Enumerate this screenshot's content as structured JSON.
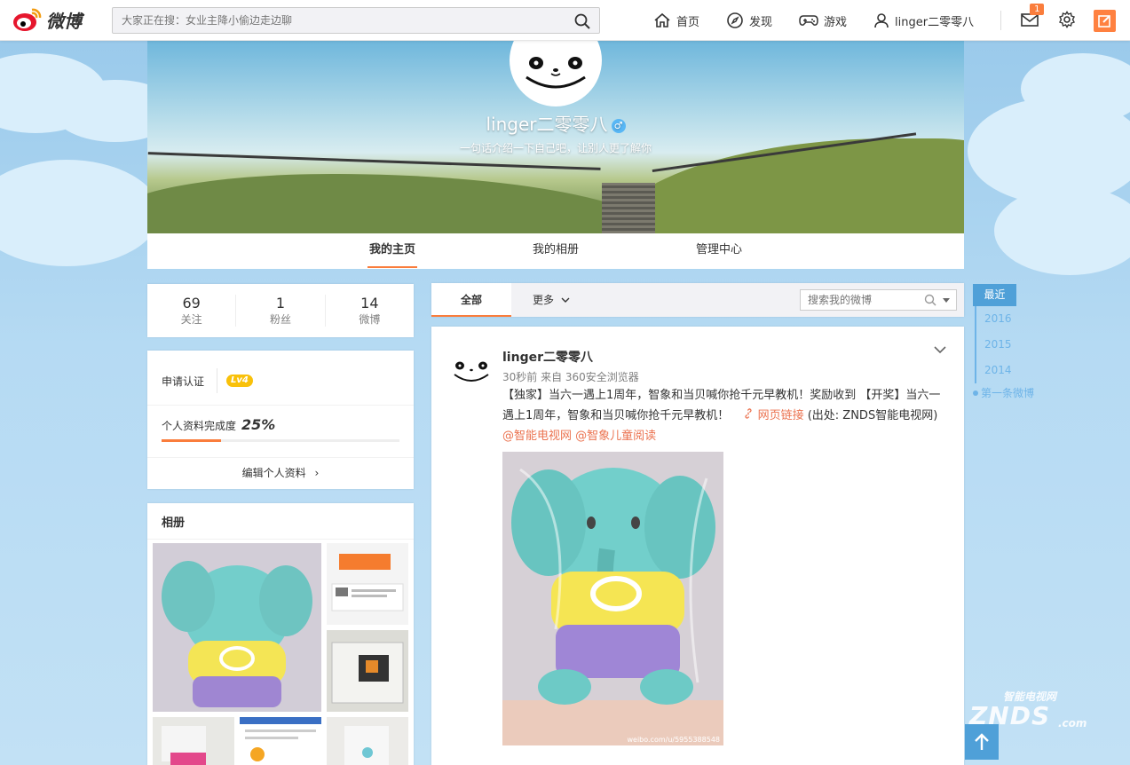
{
  "topbar": {
    "logo_text": "微博",
    "search_placeholder": "大家正在搜：女业主降小偷边走边聊",
    "nav": {
      "home": "首页",
      "discover": "发现",
      "game": "游戏",
      "user": "linger二零零八"
    },
    "message_badge": "1"
  },
  "profile": {
    "name": "linger二零零八",
    "gender_symbol": "♂",
    "intro": "一句话介绍一下自己吧，让别人更了解你"
  },
  "tabs": [
    "我的主页",
    "我的相册",
    "管理中心"
  ],
  "stats": [
    {
      "num": "69",
      "label": "关注"
    },
    {
      "num": "1",
      "label": "粉丝"
    },
    {
      "num": "14",
      "label": "微博"
    }
  ],
  "verify": {
    "apply_label": "申请认证",
    "level": "Lv4",
    "completeness_label": "个人资料完成度",
    "completeness_value": "25%",
    "completeness_fraction": 0.25,
    "edit_label": "编辑个人资料"
  },
  "album": {
    "title": "相册"
  },
  "feed": {
    "tab_all": "全部",
    "tab_more": "更多",
    "search_placeholder": "搜索我的微博"
  },
  "post": {
    "author": "linger二零零八",
    "meta": "30秒前 来自 360安全浏览器",
    "text_1": "【独家】当六一遇上1周年，智象和当贝喊你抢千元早教机！奖励收到 【开奖】当六一遇上1周年，智象和当贝喊你抢千元早教机！",
    "link_text": "网页链接",
    "text_2": "(出处: ZNDS智能电视网)",
    "mention_1": "@智能电视网",
    "mention_2": "@智象儿童阅读",
    "image_watermark": "weibo.com/u/5955388548"
  },
  "timeline": {
    "recent": "最近",
    "years": [
      "2016",
      "2015",
      "2014"
    ],
    "first": "第一条微博"
  },
  "watermark": {
    "top": "智能电视网",
    "main": "ZNDS",
    "suffix": ".com"
  },
  "colors": {
    "accent": "#fa7d3c",
    "link": "#eb7350",
    "timeline": "#4fa0d8"
  }
}
